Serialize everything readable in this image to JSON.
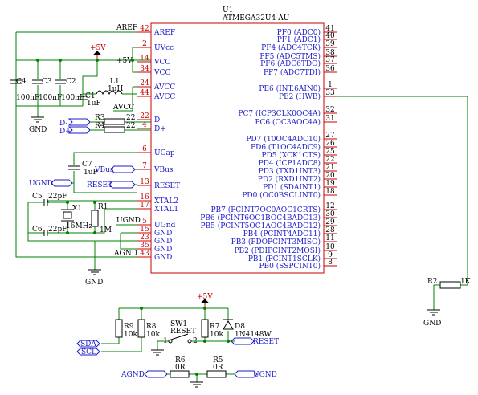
{
  "u1": {
    "ref": "U1",
    "part": "ATMEGA32U4-AU",
    "left_pins": [
      {
        "num": "42",
        "name": "AREF"
      },
      {
        "num": "2",
        "name": "UVcc"
      },
      {
        "num": "14",
        "name": "VCC"
      },
      {
        "num": "34",
        "name": "VCC"
      },
      {
        "num": "24",
        "name": "AVCC"
      },
      {
        "num": "44",
        "name": "AVCC"
      },
      {
        "num": "22",
        "name": "D-"
      },
      {
        "num": "4",
        "name": "D+"
      },
      {
        "num": "6",
        "name": "UCap"
      },
      {
        "num": "7",
        "name": "VBus"
      },
      {
        "num": "13",
        "name": "RESET"
      },
      {
        "num": "16",
        "name": "XTAL2"
      },
      {
        "num": "17",
        "name": "XTAL1"
      },
      {
        "num": "5",
        "name": "UGnd"
      },
      {
        "num": "15",
        "name": "GND"
      },
      {
        "num": "23",
        "name": "GND"
      },
      {
        "num": "35",
        "name": "GND"
      },
      {
        "num": "43",
        "name": "GND"
      }
    ],
    "right_pins": [
      {
        "num": "41",
        "name": "PF0 (ADC0)"
      },
      {
        "num": "40",
        "name": "PF1 (ADC1)"
      },
      {
        "num": "39",
        "name": "PF4 (ADC4TCK)"
      },
      {
        "num": "38",
        "name": "PF5 (ADC5TMS)"
      },
      {
        "num": "37",
        "name": "PF6 (ADC6TDO)"
      },
      {
        "num": "36",
        "name": "PF7 (ADC7TDI)"
      },
      {
        "num": "1",
        "name": "PE6 (INT.6AIN0)"
      },
      {
        "num": "33",
        "name": "PE2 (HWB)"
      },
      {
        "num": "32",
        "name": "PC7 (ICP3CLK0OC4A)"
      },
      {
        "num": "31",
        "name": "PC6 (OC3AOC4A)"
      },
      {
        "num": "27",
        "name": "PD7 (T0OC4ADC10)"
      },
      {
        "num": "26",
        "name": "PD6 (T1OC4ADC9)"
      },
      {
        "num": "25",
        "name": "PD5 (XCK1CTS)"
      },
      {
        "num": "22",
        "name": "PD4 (ICP1ADC8)"
      },
      {
        "num": "21",
        "name": "PD3 (TXD1INT3)"
      },
      {
        "num": "20",
        "name": "PD2 (RXD1INT2)"
      },
      {
        "num": "19",
        "name": "PD1 (SDAINT1)"
      },
      {
        "num": "18",
        "name": "PD0 (OC0BSCLINT0)"
      },
      {
        "num": "12",
        "name": "PB7 (PCINT7OC0AOC1CRTS)"
      },
      {
        "num": "30",
        "name": "PB6 (PCINT6OC1BOC4BADC13)"
      },
      {
        "num": "29",
        "name": "PB5 (PCINT5OC1AOC4BADC12)"
      },
      {
        "num": "28",
        "name": "PB4 (PCINT4ADC11)"
      },
      {
        "num": "11",
        "name": "PB3 (PDOPCINT3MISO)"
      },
      {
        "num": "10",
        "name": "PB2 (PDIPCINT2MOSI)"
      },
      {
        "num": "9",
        "name": "PB1 (PCINT1SCLK)"
      },
      {
        "num": "8",
        "name": "PB0 (SSPCINT0)"
      }
    ]
  },
  "nets": {
    "aref": "AREF",
    "vcc5": "+5V",
    "vcc5b": "+5V",
    "vcc5c": "+5V",
    "avcc": "AVCC",
    "ugnd_a": "UGND",
    "ugnd_b": "UGND",
    "agnd_a": "AGND",
    "agnd_b": "AGND",
    "ugnd_c": "UGND",
    "reset_a": "RESET",
    "reset_b": "RESET",
    "vbus": "VBus",
    "dminus": "D-",
    "dplus": "D+",
    "sda": "SDA",
    "scl": "SCL",
    "gnd1": "GND",
    "gnd2": "GND",
    "gnd3": "GND"
  },
  "parts": {
    "c4": {
      "ref": "C4",
      "val": "100nF"
    },
    "c3": {
      "ref": "C3",
      "val": "100nF"
    },
    "c2": {
      "ref": "C2",
      "val": "100nF"
    },
    "c1": {
      "ref": "C1",
      "val": "1uF"
    },
    "l1": {
      "ref": "L1",
      "val": "1uH"
    },
    "r3": {
      "ref": "R3",
      "val": "22"
    },
    "r4": {
      "ref": "R4",
      "val": "22"
    },
    "c7": {
      "ref": "C7",
      "val": "1uF"
    },
    "c5": {
      "ref": "C5",
      "val": "22pF"
    },
    "c6": {
      "ref": "C6",
      "val": "22pF"
    },
    "x1": {
      "ref": "X1",
      "val": "16MHz"
    },
    "r1": {
      "ref": "R1",
      "val": "1M"
    },
    "r2": {
      "ref": "R2",
      "val": "1K"
    },
    "r9": {
      "ref": "R9",
      "val": "10k"
    },
    "r8": {
      "ref": "R8",
      "val": "10k"
    },
    "sw1": {
      "ref": "SW1",
      "val": "RESET",
      "p1": "1",
      "p2": "2"
    },
    "r7": {
      "ref": "R7",
      "val": "10k"
    },
    "d8": {
      "ref": "D8",
      "val": "1N4148W"
    },
    "r6": {
      "ref": "R6",
      "val": "0R"
    },
    "r5": {
      "ref": "R5",
      "val": "0R"
    }
  },
  "colors": {
    "wire": "#008000",
    "pin": "#c80000",
    "label": "#1c1cc8",
    "body": "#000000"
  }
}
